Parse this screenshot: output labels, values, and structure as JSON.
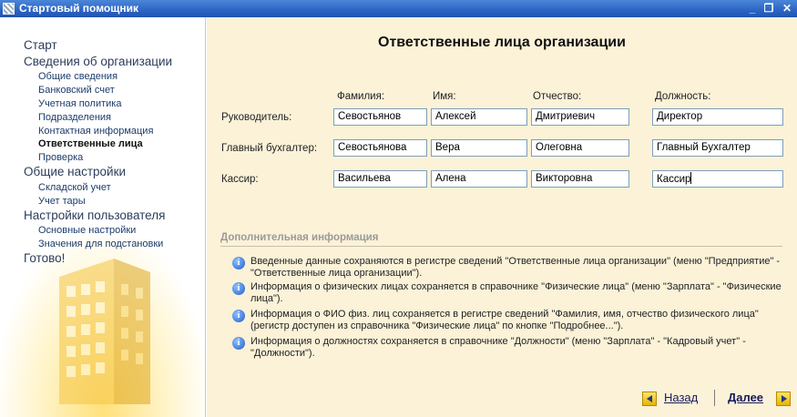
{
  "window": {
    "title": "Стартовый помощник",
    "minimize": "_",
    "restore": "❐",
    "close": "✕"
  },
  "sidebar": {
    "items": [
      {
        "label": "Старт",
        "level": 1
      },
      {
        "label": "Сведения об организации",
        "level": 1
      },
      {
        "label": "Общие сведения",
        "level": 2
      },
      {
        "label": "Банковский счет",
        "level": 2
      },
      {
        "label": "Учетная политика",
        "level": 2
      },
      {
        "label": "Подразделения",
        "level": 2
      },
      {
        "label": "Контактная информация",
        "level": 2
      },
      {
        "label": "Ответственные лица",
        "level": 2,
        "active": true
      },
      {
        "label": "Проверка",
        "level": 2
      },
      {
        "label": "Общие настройки",
        "level": 1
      },
      {
        "label": "Складской учет",
        "level": 2
      },
      {
        "label": "Учет тары",
        "level": 2
      },
      {
        "label": "Настройки пользователя",
        "level": 1
      },
      {
        "label": "Основные настройки",
        "level": 2
      },
      {
        "label": "Значения для подстановки",
        "level": 2
      },
      {
        "label": "Готово!",
        "level": 1
      }
    ]
  },
  "main": {
    "title": "Ответственные лица организации",
    "columns": [
      "Фамилия:",
      "Имя:",
      "Отчество:",
      "Должность:"
    ],
    "rows": [
      {
        "label": "Руководитель:",
        "surname": "Севостьянов",
        "name": "Алексей",
        "patronymic": "Дмитриевич",
        "position": "Директор"
      },
      {
        "label": "Главный бухгалтер:",
        "surname": "Севостьянова",
        "name": "Вера",
        "patronymic": "Олеговна",
        "position": "Главный Бухгалтер"
      },
      {
        "label": "Кассир:",
        "surname": "Васильева",
        "name": "Алена",
        "patronymic": "Викторовна",
        "position": "Кассир"
      }
    ],
    "info": {
      "heading": "Дополнительная информация",
      "items": [
        "Введенные данные сохраняются в регистре сведений \"Ответственные лица организации\" (меню \"Предприятие\" - \"Ответственные лица организации\").",
        "Информация о физических лицах сохраняется в справочнике \"Физические лица\" (меню \"Зарплата\" - \"Физические лица\").",
        "Информация о ФИО физ. лиц сохраняется в регистре сведений \"Фамилия, имя, отчество физического лица\" (регистр доступен из справочника \"Физические лица\" по кнопке \"Подробнее...\").",
        "Информация о должностях сохраняется в справочнике \"Должности\" (меню \"Зарплата\" - \"Кадровый учет\" - \"Должности\")."
      ]
    },
    "nav": {
      "back": "Назад",
      "next": "Далее"
    }
  }
}
